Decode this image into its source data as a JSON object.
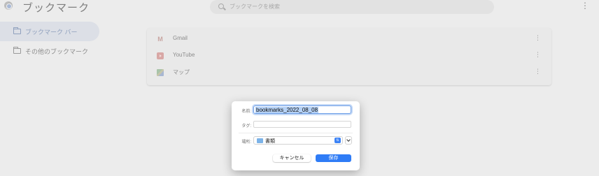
{
  "app": {
    "title": "ブックマーク",
    "search_placeholder": "ブックマークを検索"
  },
  "sidebar": {
    "items": [
      {
        "label": "ブックマーク バー",
        "active": true
      },
      {
        "label": "その他のブックマーク",
        "active": false
      }
    ]
  },
  "bookmarks": [
    {
      "title": "Gmail",
      "icon": "gmail-icon"
    },
    {
      "title": "YouTube",
      "icon": "youtube-icon"
    },
    {
      "title": "マップ",
      "icon": "maps-icon"
    }
  ],
  "save_dialog": {
    "name_label": "名前:",
    "name_value": "bookmarks_2022_08_08",
    "tags_label": "タグ:",
    "tags_value": "",
    "where_label": "場所:",
    "where_value": "書類",
    "cancel_label": "キャンセル",
    "save_label": "保存"
  },
  "colors": {
    "accent": "#2f7cf6",
    "selection": "#b5d1f5",
    "sidebar_active": "#dcdfe6"
  }
}
